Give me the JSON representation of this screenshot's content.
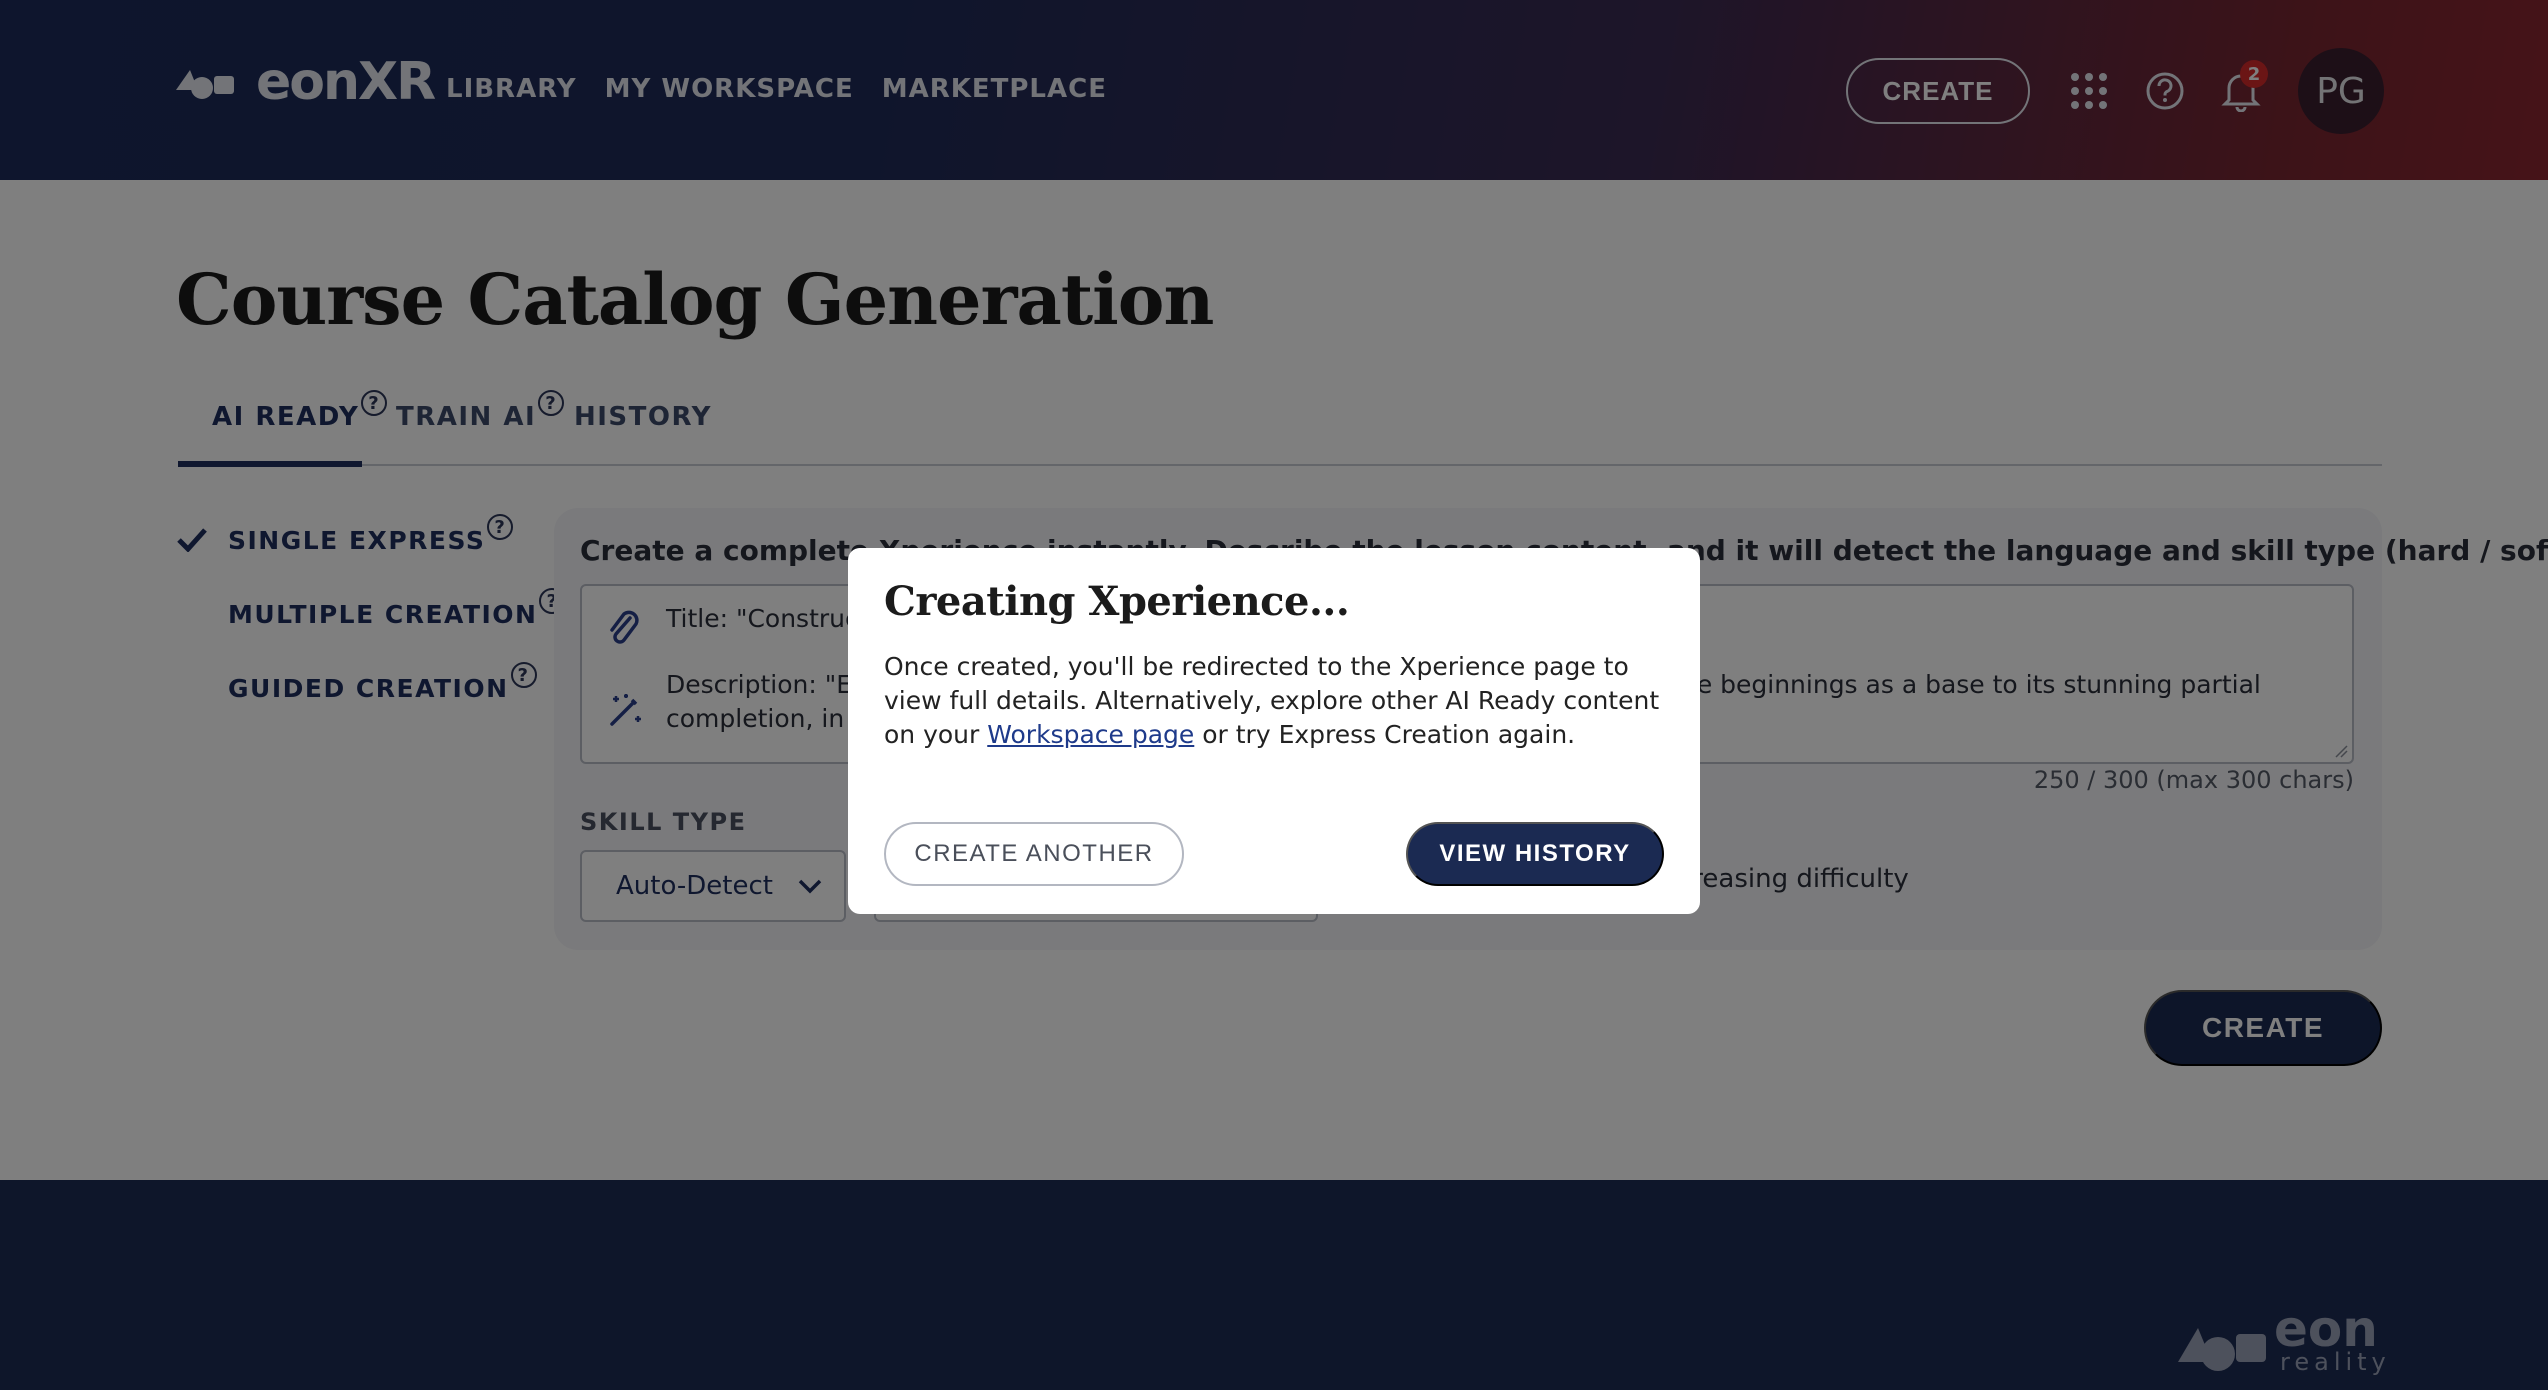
{
  "header": {
    "logo_text": "eonXR",
    "nav": [
      "LIBRARY",
      "MY WORKSPACE",
      "MARKETPLACE"
    ],
    "create_label": "CREATE",
    "icons": [
      "apps-grid-icon",
      "help-icon",
      "bell-icon"
    ],
    "notification_count": "2",
    "avatar_initials": "PG"
  },
  "main": {
    "title": "Course Catalog Generation",
    "tabs": [
      {
        "label": "AI READY",
        "active": true,
        "has_help": true
      },
      {
        "label": "TRAIN AI",
        "has_help": true
      },
      {
        "label": "HISTORY"
      }
    ],
    "side_items": [
      {
        "label": "SINGLE EXPRESS",
        "selected": true
      },
      {
        "label": "MULTIPLE CREATION"
      },
      {
        "label": "GUIDED CREATION"
      }
    ],
    "panel_description": "Create a complete Xperience instantly. Describe the lesson content, and it will detect the language and skill type (hard / soft)",
    "textarea": {
      "line1": "Title: \"Constructi",
      "line2_left": "Description: \"Exp",
      "line2_right": "ble beginnings as a base to its stunning partial",
      "line3": "completion, in th"
    },
    "char_counter": "250 / 300 (max 300 chars)",
    "skill_type_label": "SKILL TYPE",
    "skill_type_value": "Auto-Detect",
    "difficulty_text": "creasing difficulty",
    "create_label": "CREATE"
  },
  "footer": {
    "logo_word": "eon",
    "logo_subword": "reality"
  },
  "modal": {
    "title": "Creating Xperience...",
    "body_before": "Once created, you'll be redirected to the Xperience page to view full details. Alternatively, explore other AI Ready content on your ",
    "link": "Workspace page",
    "body_after": " or try Express Creation again.",
    "secondary_button": "CREATE ANOTHER",
    "primary_button": "VIEW HISTORY"
  },
  "colors": {
    "navy": "#1b2a52",
    "header_gradient_start": "#1c2b5a",
    "header_gradient_end": "#8c2630",
    "notification_badge": "#d62b2b"
  }
}
